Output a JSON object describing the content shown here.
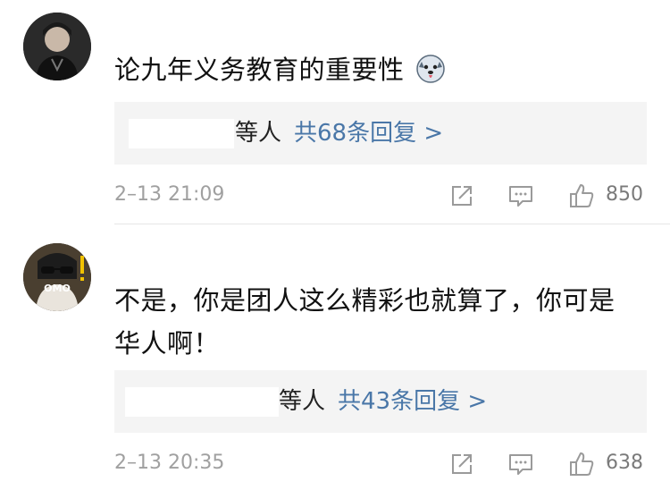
{
  "comments": [
    {
      "text": "论九年义务教育的重要性",
      "emoji": "husky-emoji",
      "reply_box": {
        "others": "等人",
        "count_text": "共68条回复 >"
      },
      "time": "2–13 21:09",
      "likes": "850"
    },
    {
      "avatar_badge": "OMO",
      "text_line1": "不是，你是团人这么精彩也就算了，你可是",
      "text_line2": "华人啊！",
      "reply_box": {
        "others": "等人",
        "count_text": "共43条回复 >"
      },
      "time": "2–13 20:35",
      "likes": "638"
    }
  ],
  "colors": {
    "link": "#4a77a8",
    "meta_gray": "#a0a0a0",
    "reply_bg": "#f4f4f4"
  }
}
